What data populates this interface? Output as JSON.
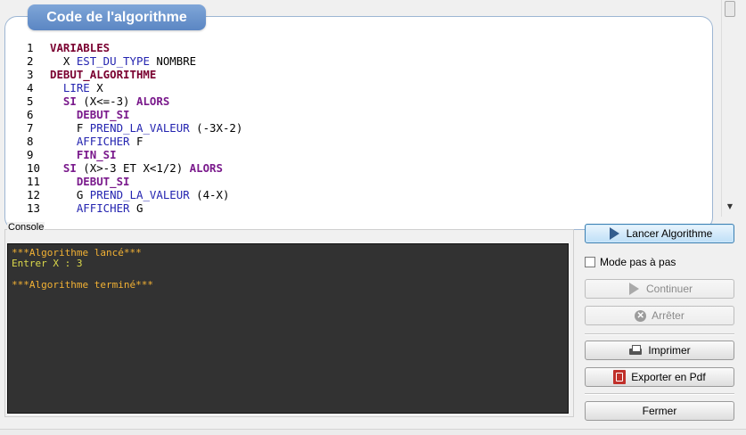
{
  "code_panel": {
    "title": "Code de l'algorithme",
    "lines": [
      {
        "num": "1",
        "segments": [
          {
            "t": "VARIABLES",
            "c": "kw"
          }
        ]
      },
      {
        "num": "2",
        "segments": [
          {
            "t": "  X ",
            "c": "text"
          },
          {
            "t": "EST_DU_TYPE",
            "c": "instr"
          },
          {
            "t": " NOMBRE",
            "c": "text"
          }
        ]
      },
      {
        "num": "3",
        "segments": [
          {
            "t": "DEBUT_ALGORITHME",
            "c": "kw"
          }
        ]
      },
      {
        "num": "4",
        "segments": [
          {
            "t": "  ",
            "c": "text"
          },
          {
            "t": "LIRE",
            "c": "instr"
          },
          {
            "t": " X",
            "c": "text"
          }
        ]
      },
      {
        "num": "5",
        "segments": [
          {
            "t": "  ",
            "c": "text"
          },
          {
            "t": "SI",
            "c": "ctrl"
          },
          {
            "t": " (X<=-3) ",
            "c": "text"
          },
          {
            "t": "ALORS",
            "c": "ctrl"
          }
        ]
      },
      {
        "num": "6",
        "segments": [
          {
            "t": "    ",
            "c": "text"
          },
          {
            "t": "DEBUT_SI",
            "c": "ctrl"
          }
        ]
      },
      {
        "num": "7",
        "segments": [
          {
            "t": "    F ",
            "c": "text"
          },
          {
            "t": "PREND_LA_VALEUR",
            "c": "instr"
          },
          {
            "t": " (-3X-2)",
            "c": "text"
          }
        ]
      },
      {
        "num": "8",
        "segments": [
          {
            "t": "    ",
            "c": "text"
          },
          {
            "t": "AFFICHER",
            "c": "instr"
          },
          {
            "t": " F",
            "c": "text"
          }
        ]
      },
      {
        "num": "9",
        "segments": [
          {
            "t": "    ",
            "c": "text"
          },
          {
            "t": "FIN_SI",
            "c": "ctrl"
          }
        ]
      },
      {
        "num": "10",
        "segments": [
          {
            "t": "  ",
            "c": "text"
          },
          {
            "t": "SI",
            "c": "ctrl"
          },
          {
            "t": " (X>-3 ET X<1/2) ",
            "c": "text"
          },
          {
            "t": "ALORS",
            "c": "ctrl"
          }
        ]
      },
      {
        "num": "11",
        "segments": [
          {
            "t": "    ",
            "c": "text"
          },
          {
            "t": "DEBUT_SI",
            "c": "ctrl"
          }
        ]
      },
      {
        "num": "12",
        "segments": [
          {
            "t": "    G ",
            "c": "text"
          },
          {
            "t": "PREND_LA_VALEUR",
            "c": "instr"
          },
          {
            "t": " (4-X)",
            "c": "text"
          }
        ]
      },
      {
        "num": "13",
        "segments": [
          {
            "t": "    ",
            "c": "text"
          },
          {
            "t": "AFFICHER",
            "c": "instr"
          },
          {
            "t": " G",
            "c": "text"
          }
        ]
      }
    ]
  },
  "console": {
    "label": "Console",
    "lines": [
      {
        "text": "***Algorithme lancé***",
        "color": "orange"
      },
      {
        "text": "Entrer X : 3",
        "color": "yellow"
      },
      {
        "text": "",
        "color": "yellow"
      },
      {
        "text": "***Algorithme terminé***",
        "color": "orange"
      }
    ]
  },
  "controls": {
    "run_label": "Lancer Algorithme",
    "step_mode_label": "Mode pas à pas",
    "step_mode_checked": false,
    "continue_label": "Continuer",
    "stop_label": "Arrêter",
    "print_label": "Imprimer",
    "export_label": "Exporter en Pdf",
    "close_label": "Fermer"
  },
  "colors": {
    "keyword": "#7a0030",
    "control": "#7a1a8c",
    "instruction": "#2424b0",
    "console_bg": "#323232",
    "console_orange": "#f2b134",
    "console_yellow": "#dcd94b",
    "title_badge": "#5b86c3"
  }
}
